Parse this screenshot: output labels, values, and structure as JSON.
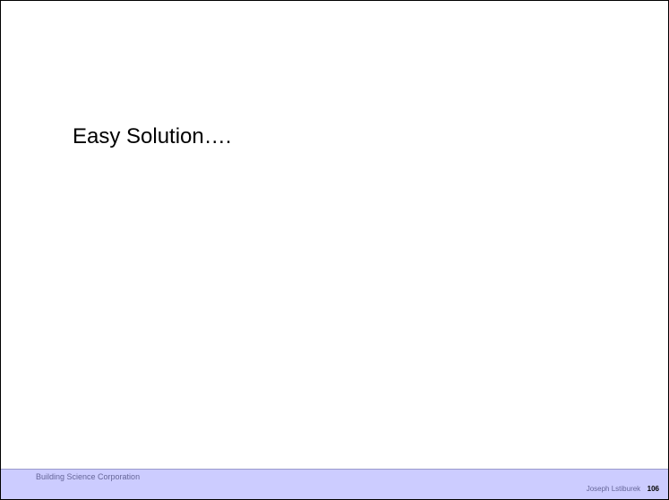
{
  "slide": {
    "title": "Easy Solution…."
  },
  "footer": {
    "organization": "Building Science Corporation",
    "author": "Joseph Lstiburek",
    "page_number": "106"
  },
  "colors": {
    "footer_background": "#ccccff",
    "footer_text": "#666699",
    "slide_border": "#000000"
  }
}
